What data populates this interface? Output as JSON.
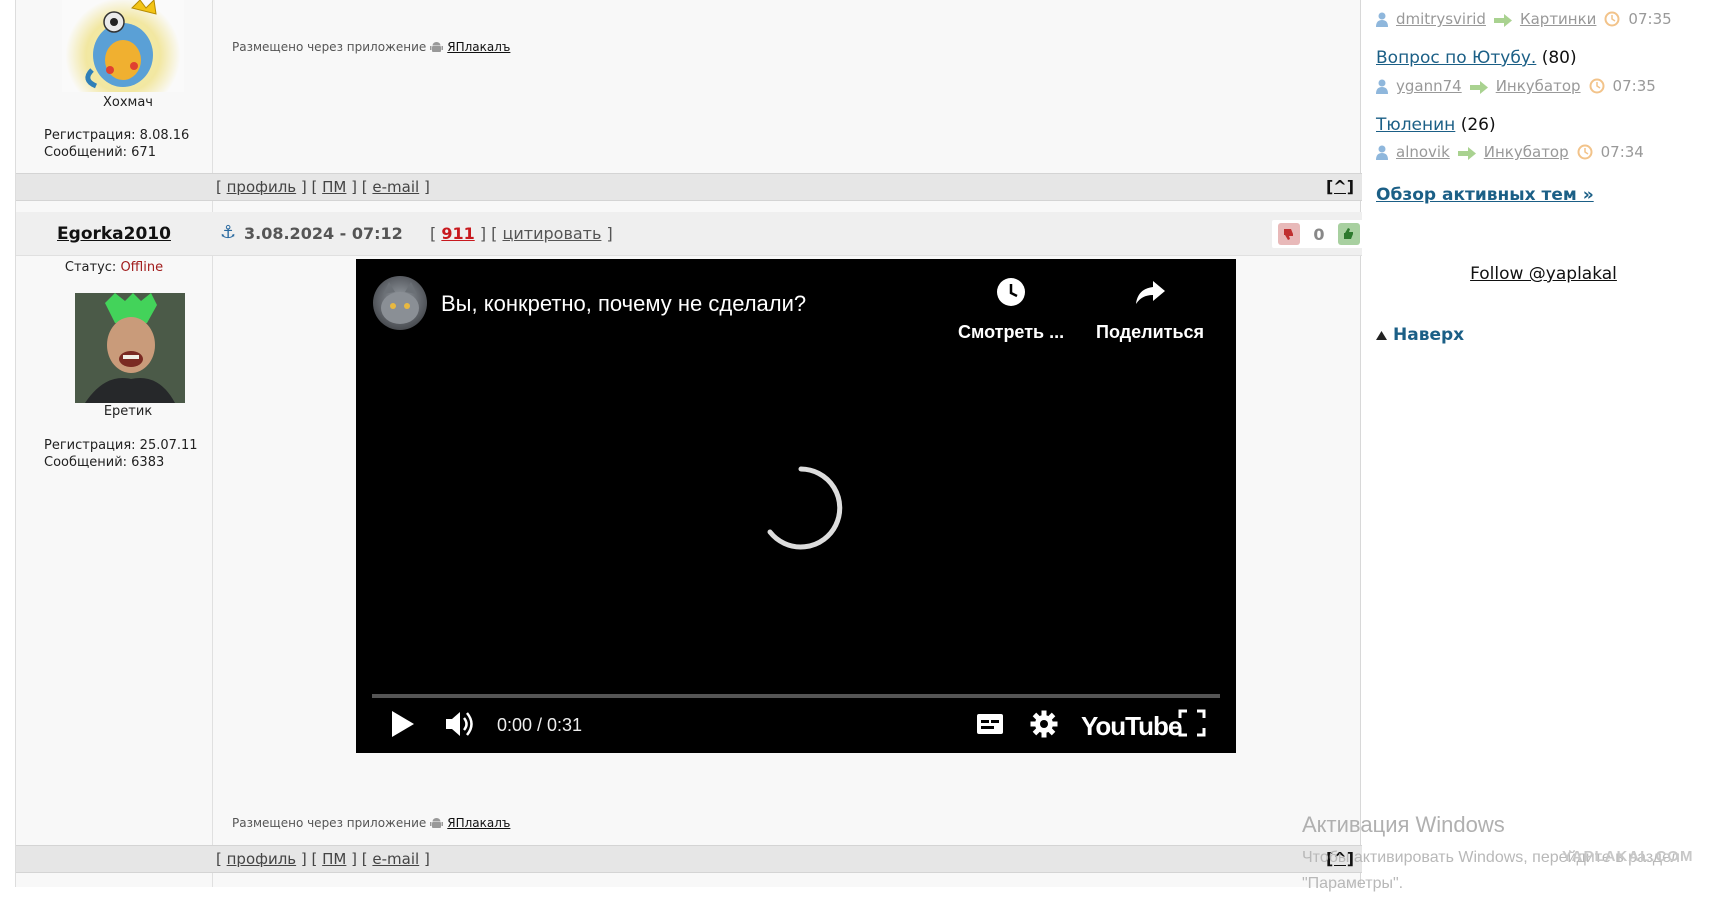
{
  "post1": {
    "user_title": "Хохмач",
    "reg_label": "Регистрация: 8.08.16",
    "msgs_label": "Сообщений: 671",
    "app_note": "Размещено через приложение",
    "app_name": "ЯПлакалъ"
  },
  "bar": {
    "profile": "профиль",
    "pm": "ПМ",
    "email": "e-mail",
    "up": "[^]"
  },
  "post2": {
    "username": "Egorka2010",
    "date": "3.08.2024 - 07:12",
    "post_number": "911",
    "quote": "цитировать",
    "rating": "0",
    "status_label": "Статус:",
    "status_value": "Offline",
    "user_title": "Еретик",
    "reg_label": "Регистрация: 25.07.11",
    "msgs_label": "Сообщений: 6383",
    "app_note": "Размещено через приложение",
    "app_name": "ЯПлакалъ"
  },
  "video": {
    "title": "Вы, конкретно, почему не сделали?",
    "watch_later": "Смотреть ...",
    "share": "Поделиться",
    "time": "0:00 / 0:31",
    "brand": "YouTube"
  },
  "sidebar": {
    "top_meta": {
      "user": "dmitrysvirid",
      "forum": "Картинки",
      "time": "07:35"
    },
    "topics": [
      {
        "title": "Вопрос по Ютубу.",
        "count": "(80)",
        "user": "ygann74",
        "forum": "Инкубатор",
        "time": "07:35"
      },
      {
        "title": "Тюленин",
        "count": "(26)",
        "user": "alnovik",
        "forum": "Инкубатор",
        "time": "07:34"
      }
    ],
    "overview": "Обзор активных тем »",
    "follow": "Follow @yaplakal",
    "naverh": "Наверх"
  },
  "windows": {
    "activation": "Активация Windows",
    "line1": "Чтобы активировать Windows, перейдите в раздел",
    "line2": "\"Параметры\"."
  },
  "watermark": "YAPLAKAL.COM",
  "colors": {
    "accent": "#1b5f86",
    "offline": "#a11c1c",
    "post_number": "#c8191e"
  }
}
